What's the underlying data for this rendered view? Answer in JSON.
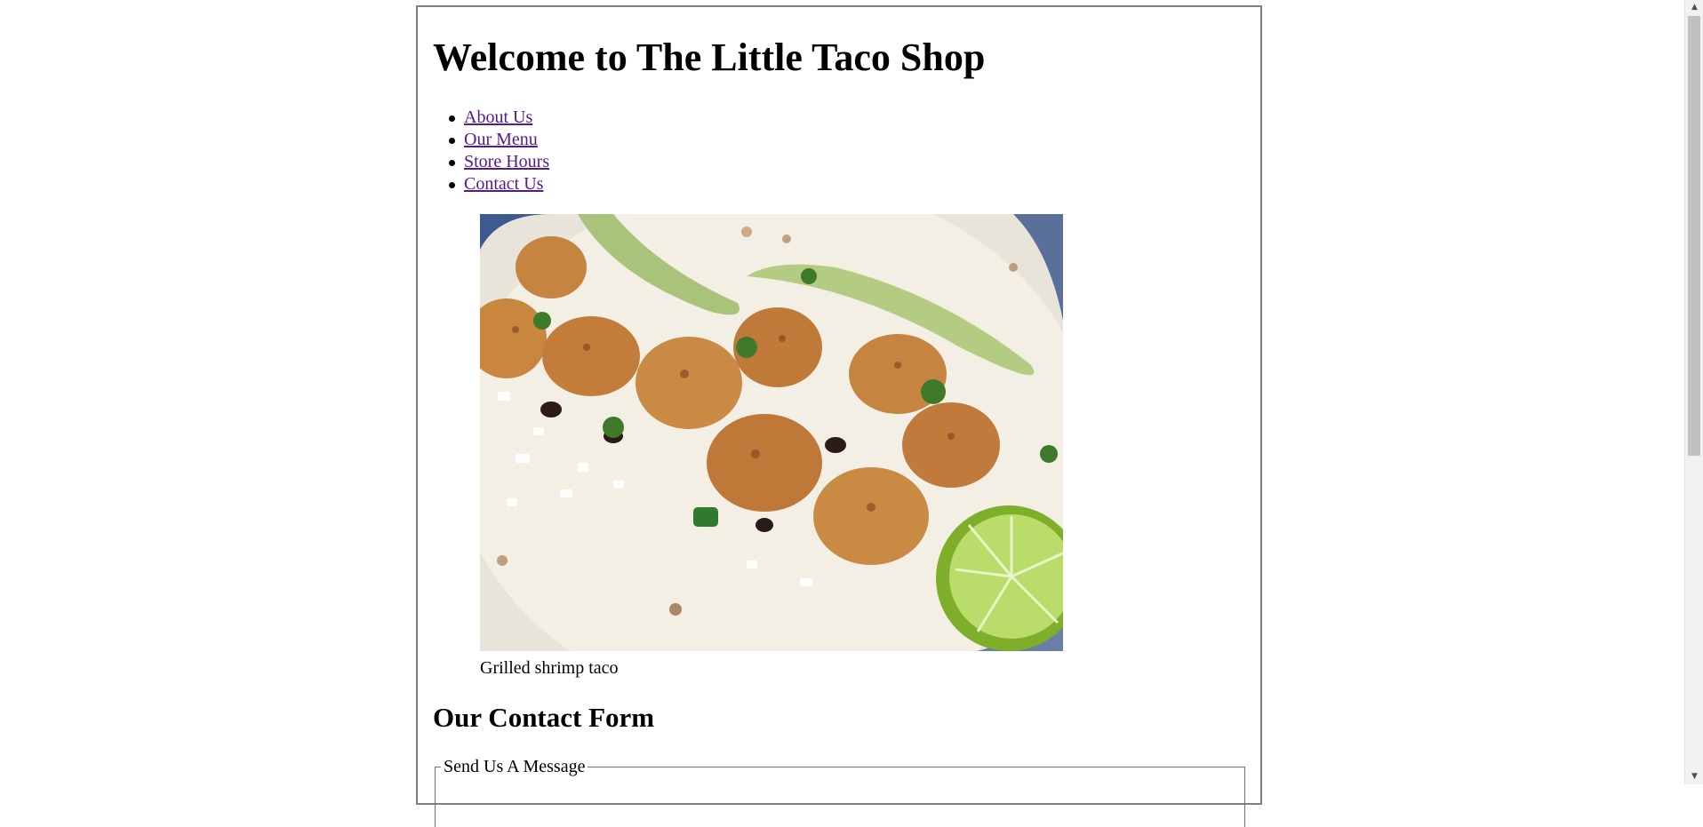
{
  "page": {
    "heading": "Welcome to The Little Taco Shop"
  },
  "nav": {
    "items": [
      {
        "label": "About Us"
      },
      {
        "label": "Our Menu"
      },
      {
        "label": "Store Hours"
      },
      {
        "label": "Contact Us"
      }
    ]
  },
  "figure": {
    "image_subject": "grilled shrimp taco photo",
    "caption": "Grilled shrimp taco"
  },
  "contact": {
    "heading": "Our Contact Form",
    "fieldset_legend": "Send Us A Message"
  },
  "colors": {
    "link_visited": "#551a8b",
    "page_border": "#808080",
    "scrollbar_track": "#f1f1f1",
    "scrollbar_thumb": "#c1c1c1"
  },
  "scrollbar": {
    "up_icon": "triangle-up",
    "down_icon": "triangle-down"
  }
}
